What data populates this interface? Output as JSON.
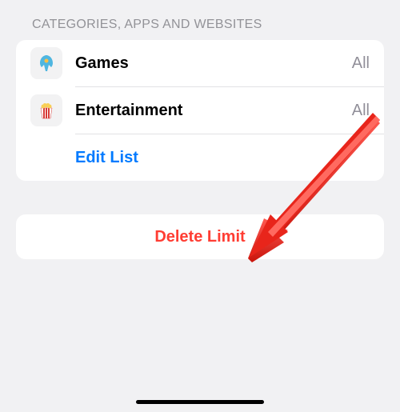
{
  "section_header": "Categories, Apps and Websites",
  "list": {
    "items": [
      {
        "icon": "rocket-icon",
        "label": "Games",
        "value": "All"
      },
      {
        "icon": "popcorn-icon",
        "label": "Entertainment",
        "value": "All"
      }
    ],
    "edit_label": "Edit List"
  },
  "delete_label": "Delete Limit",
  "colors": {
    "accent_blue": "#007aff",
    "destructive_red": "#ff3d33",
    "secondary_text": "#918f99",
    "header_text": "#929297",
    "background": "#f1f1f3",
    "card": "#ffffff",
    "divider": "#e2e2e5"
  }
}
